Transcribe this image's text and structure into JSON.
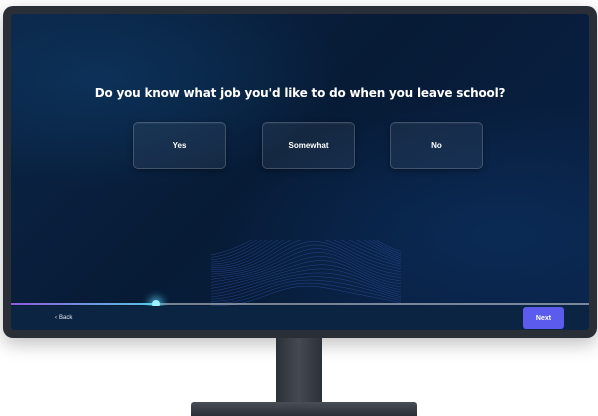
{
  "question": "Do you know what job you'd like to do when you leave school?",
  "options": [
    {
      "label": "Yes"
    },
    {
      "label": "Somewhat"
    },
    {
      "label": "No"
    }
  ],
  "progress": 0.25,
  "navigation": {
    "back_label": "Back",
    "back_icon": "chevron-left-icon",
    "next_label": "Next"
  },
  "colors": {
    "accent": "#5b5bee",
    "background": "#071b36",
    "progress_start": "#8e5bd9",
    "progress_end": "#56c7e6"
  }
}
